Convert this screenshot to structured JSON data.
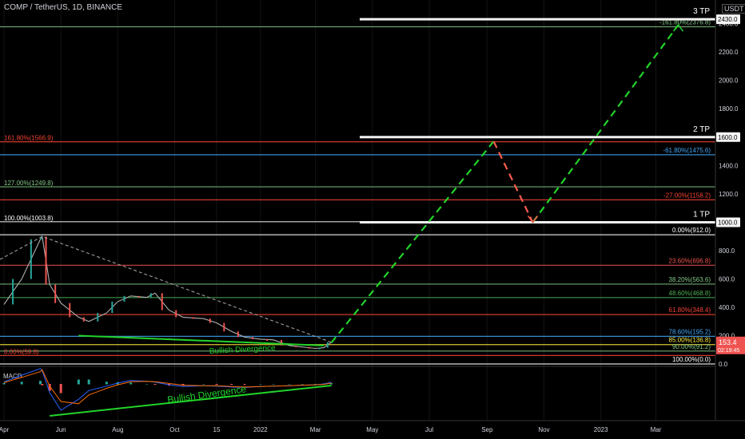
{
  "header": {
    "title": "COMP / TetherUS, 1D, BINANCE",
    "currency": "USDT"
  },
  "colors": {
    "background": "#000000",
    "up": "#26a69a",
    "down": "#ef5350",
    "projection": "#22d32a",
    "drop": "#f55b4b",
    "macd": "#2962ff",
    "signal": "#ff6d00"
  },
  "chart_data": [
    {
      "type": "line",
      "title": "COMP / TetherUS, 1D, BINANCE",
      "price_axis": {
        "ticks": [
          0,
          200,
          400,
          600,
          800,
          1000,
          1200,
          1400,
          1600,
          1800,
          2000,
          2200,
          2400
        ],
        "labels": [
          "0.0",
          "200.0",
          "400.0",
          "600.0",
          "800.0",
          "1000.0",
          "1200.0",
          "1400.0",
          "1600.0",
          "1800.0",
          "2000.0",
          "2200.0",
          "2400.0"
        ],
        "ylim": [
          0,
          2500
        ],
        "scale": "log"
      },
      "time_axis": {
        "labels": [
          "Apr",
          "Jun",
          "Aug",
          "Oct",
          "15",
          "2022",
          "Mar",
          "May",
          "Jul",
          "Sep",
          "Nov",
          "2023",
          "Mar"
        ],
        "label_dates": [
          "2021-04-01",
          "2021-06-01",
          "2021-08-01",
          "2021-10-01",
          "2021-11-15",
          "2022-01-01",
          "2022-03-01",
          "2022-05-01",
          "2022-07-01",
          "2022-09-01",
          "2022-11-01",
          "2023-01-01",
          "2023-03-01"
        ]
      },
      "price_markers": [
        {
          "label": "1000.0",
          "value": 1000
        },
        {
          "label": "1600.0",
          "value": 1600
        },
        {
          "label": "2430.0",
          "value": 2430
        }
      ],
      "current_price": {
        "value": 153.4,
        "label": "153.4",
        "countdown": "02:19:45"
      },
      "fib_levels": [
        {
          "label": "0.00%(912.0)",
          "value": 912.0,
          "color": "#ffffff",
          "side": "right"
        },
        {
          "label": "23.60%(696.8)",
          "value": 696.8,
          "color": "#f05350",
          "side": "right"
        },
        {
          "label": "38.20%(563.6)",
          "value": 563.6,
          "color": "#81c784",
          "side": "right"
        },
        {
          "label": "48.60%(468.8)",
          "value": 468.8,
          "color": "#4caf50",
          "side": "right"
        },
        {
          "label": "61.80%(348.4)",
          "value": 348.4,
          "color": "#f44336",
          "side": "right"
        },
        {
          "label": "78.60%(195.2)",
          "value": 195.2,
          "color": "#42a5f5",
          "side": "right"
        },
        {
          "label": "85.00%(136.8)",
          "value": 136.8,
          "color": "#ffeb3b",
          "side": "right"
        },
        {
          "label": "90.00%(91.2)",
          "value": 91.2,
          "color": "#81c784",
          "side": "right"
        },
        {
          "label": "100.00%(0.0)",
          "value": 0.0,
          "color": "#ffffff",
          "side": "right"
        },
        {
          "label": "100.00%(1003.8)",
          "value": 1003.8,
          "color": "#ffffff",
          "side": "left"
        },
        {
          "label": "127.00%(1249.8)",
          "value": 1249.8,
          "color": "#81c784",
          "side": "left"
        },
        {
          "label": "161.80%(1566.9)",
          "value": 1566.9,
          "color": "#f44336",
          "side": "left"
        },
        {
          "label": "0.00%(59.8)",
          "value": 59.8,
          "color": "#f44336",
          "side": "left"
        },
        {
          "label": "-27.00%(1158.2)",
          "value": 1158.2,
          "color": "#f44336",
          "side": "right"
        },
        {
          "label": "-61.80%(1475.6)",
          "value": 1475.6,
          "color": "#42a5f5",
          "side": "right"
        },
        {
          "label": "-161.80%(2376.8)",
          "value": 2376.8,
          "color": "#81c784",
          "side": "right"
        }
      ],
      "targets": [
        {
          "label": "1 TP",
          "value": 1000
        },
        {
          "label": "2 TP",
          "value": 1600
        },
        {
          "label": "3 TP",
          "value": 2430
        }
      ],
      "projection": {
        "path_dates": [
          "2022-03-18",
          "2022-09-08",
          "2022-10-20",
          "2023-03-25"
        ],
        "path_values": [
          150,
          1570,
          1000,
          2390
        ]
      },
      "price_series": {
        "dates": [
          "2021-04-01",
          "2021-04-20",
          "2021-05-10",
          "2021-05-12",
          "2021-05-20",
          "2021-06-01",
          "2021-06-20",
          "2021-07-01",
          "2021-07-20",
          "2021-08-01",
          "2021-08-15",
          "2021-09-01",
          "2021-09-10",
          "2021-09-25",
          "2021-10-10",
          "2021-11-01",
          "2021-11-15",
          "2021-12-01",
          "2021-12-15",
          "2022-01-01",
          "2022-01-15",
          "2022-02-01",
          "2022-02-15",
          "2022-03-01",
          "2022-03-10",
          "2022-03-18"
        ],
        "values": [
          420,
          600,
          880,
          900,
          560,
          430,
          330,
          300,
          360,
          440,
          480,
          470,
          500,
          380,
          330,
          320,
          290,
          230,
          190,
          175,
          170,
          130,
          120,
          110,
          115,
          153
        ]
      },
      "annotation": "Bullish Divergence"
    },
    {
      "type": "line",
      "title": "MACD",
      "y_axis": {
        "ticks": [
          0,
          -50
        ],
        "labels": [
          "0.0",
          "-50.0"
        ]
      },
      "annotation": "Bullish Divergence",
      "series": [
        {
          "values": [
            5,
            20,
            35,
            30,
            -20,
            -60,
            -35,
            -15,
            -5,
            2,
            8,
            6,
            4,
            -2,
            -6,
            -4,
            -5,
            -7,
            -8,
            -6,
            -5,
            -4,
            -3,
            -2,
            0,
            4
          ]
        },
        {
          "values": [
            3,
            15,
            28,
            32,
            -5,
            -40,
            -45,
            -25,
            -10,
            -2,
            5,
            6,
            5,
            1,
            -3,
            -4,
            -4,
            -6,
            -7,
            -6,
            -5,
            -4,
            -3,
            -2,
            -1,
            2
          ]
        }
      ]
    }
  ]
}
